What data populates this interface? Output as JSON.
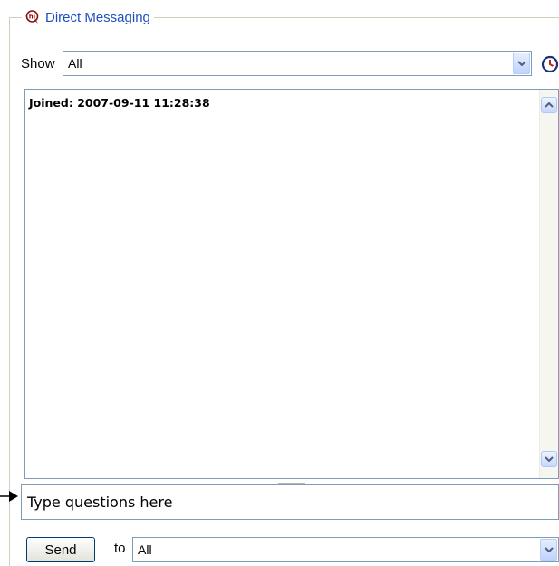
{
  "panel": {
    "title": "Direct Messaging",
    "title_icon": "chat-bubble-icon"
  },
  "filter": {
    "label": "Show",
    "selected": "All",
    "history_icon": "clock-history-icon"
  },
  "messages": {
    "lines": [
      "Joined: 2007-09-11 11:28:38"
    ]
  },
  "compose": {
    "value": "Type questions here",
    "send_label": "Send",
    "to_label": "to",
    "recipient": "All"
  },
  "colors": {
    "title_text": "#1f4fbf",
    "field_border": "#7f9db9",
    "button_border": "#003c74"
  }
}
